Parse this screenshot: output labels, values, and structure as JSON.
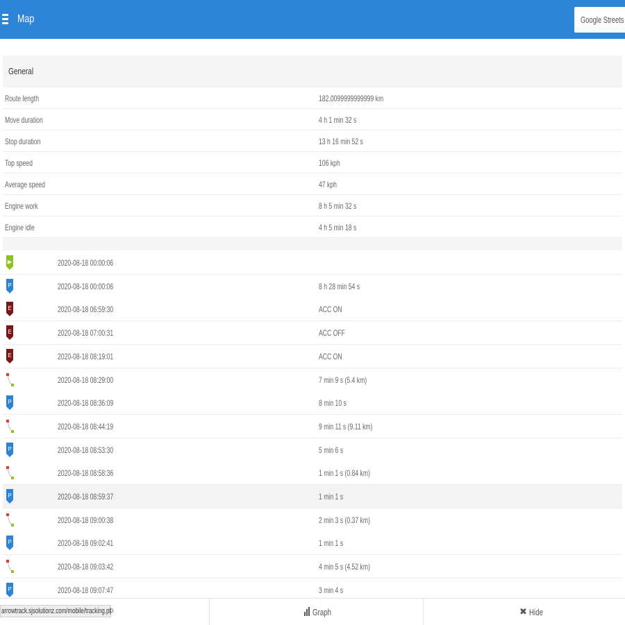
{
  "header": {
    "title": "Map",
    "layer": "Google Streets"
  },
  "general": {
    "heading": "General",
    "rows": [
      {
        "label": "Route length",
        "value": "182.0099999999999 km"
      },
      {
        "label": "Move duration",
        "value": "4 h 1 min 32 s"
      },
      {
        "label": "Stop duration",
        "value": "13 h 16 min 52 s"
      },
      {
        "label": "Top speed",
        "value": "106 kph"
      },
      {
        "label": "Average speed",
        "value": "47 kph"
      },
      {
        "label": "Engine work",
        "value": "8 h 5 min 32 s"
      },
      {
        "label": "Engine idle",
        "value": "4 h 5 min 18 s"
      }
    ]
  },
  "history": [
    {
      "type": "start",
      "time": "2020-08-18 00:00:06",
      "info": ""
    },
    {
      "type": "parking",
      "time": "2020-08-18 00:00:06",
      "info": "8 h 28 min 54 s"
    },
    {
      "type": "event",
      "time": "2020-08-18 06:59:30",
      "info": "ACC ON"
    },
    {
      "type": "event",
      "time": "2020-08-18 07:00:31",
      "info": "ACC OFF"
    },
    {
      "type": "event",
      "time": "2020-08-18 08:19:01",
      "info": "ACC ON"
    },
    {
      "type": "drive",
      "time": "2020-08-18 08:29:00",
      "info": "7 min 9 s (5.4 km)"
    },
    {
      "type": "parking",
      "time": "2020-08-18 08:36:09",
      "info": "8 min 10 s"
    },
    {
      "type": "drive",
      "time": "2020-08-18 08:44:19",
      "info": "9 min 11 s (9.11 km)"
    },
    {
      "type": "parking",
      "time": "2020-08-18 08:53:30",
      "info": "5 min 6 s"
    },
    {
      "type": "drive",
      "time": "2020-08-18 08:58:36",
      "info": "1 min 1 s (0.84 km)"
    },
    {
      "type": "parking",
      "time": "2020-08-18 08:59:37",
      "info": "1 min 1 s",
      "highlighted": true
    },
    {
      "type": "drive",
      "time": "2020-08-18 09:00:38",
      "info": "2 min 3 s (0.37 km)"
    },
    {
      "type": "parking",
      "time": "2020-08-18 09:02:41",
      "info": "1 min 1 s"
    },
    {
      "type": "drive",
      "time": "2020-08-18 09:03:42",
      "info": "4 min 5 s (4.52 km)"
    },
    {
      "type": "parking",
      "time": "2020-08-18 09:07:47",
      "info": "3 min 4 s"
    }
  ],
  "footer": {
    "status_url": "arrowtrack.sjsolutionz.com/mobile/tracking.php#",
    "partial_label": "P",
    "graph_label": "Graph",
    "hide_label": "Hide"
  },
  "icon_colors": {
    "start": "#8dc21f",
    "parking": "#2d83d6",
    "event": "#7a1818",
    "drive_start": "#e53935",
    "drive_end": "#8dc21f"
  },
  "header_color": "#2d83d6"
}
